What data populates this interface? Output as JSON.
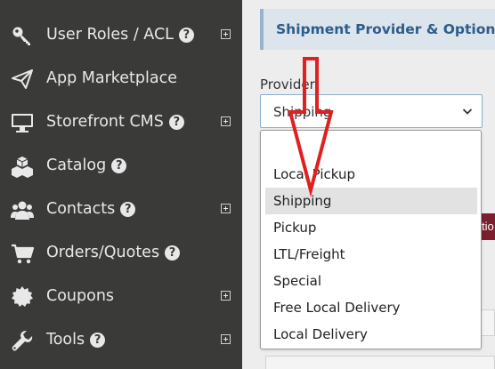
{
  "sidebar": {
    "items": [
      {
        "label": "User Roles / ACL",
        "icon": "key-icon",
        "help": "?",
        "expandable": true
      },
      {
        "label": "App Marketplace",
        "icon": "paper-plane-icon",
        "help": "",
        "expandable": false
      },
      {
        "label": "Storefront CMS",
        "icon": "monitor-icon",
        "help": "?",
        "expandable": true
      },
      {
        "label": "Catalog",
        "icon": "cubes-icon",
        "help": "?",
        "expandable": false
      },
      {
        "label": "Contacts",
        "icon": "users-icon",
        "help": "?",
        "expandable": true
      },
      {
        "label": "Orders/Quotes",
        "icon": "cart-icon",
        "help": "?",
        "expandable": false
      },
      {
        "label": "Coupons",
        "icon": "badge-icon",
        "help": "",
        "expandable": true
      },
      {
        "label": "Tools",
        "icon": "wrench-icon",
        "help": "?",
        "expandable": true
      }
    ]
  },
  "panel": {
    "title": "Shipment Provider & Options:",
    "provider_label": "Provider:",
    "selected_value": "Shipping",
    "side_button_text": "tio"
  },
  "dropdown": {
    "options": [
      "",
      "Local Pickup",
      "Shipping",
      "Pickup",
      "LTL/Freight",
      "Special",
      "Free Local Delivery",
      "Local Delivery"
    ],
    "selected_index": 2
  },
  "colors": {
    "sidebar_bg": "#3a3a38",
    "panel_title": "#2d5d8c",
    "annotation_arrow": "#e02020",
    "maroon_button": "#7a1f2e"
  }
}
